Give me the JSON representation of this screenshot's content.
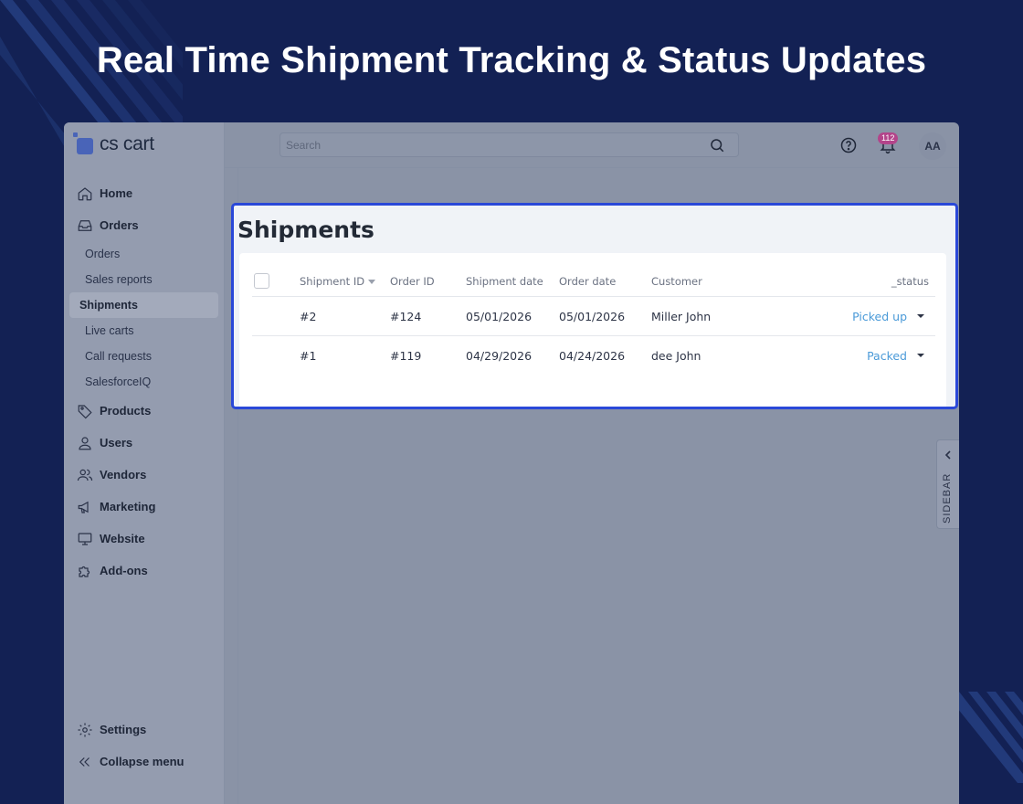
{
  "headline": "Real Time Shipment Tracking & Status Updates",
  "app": {
    "logo_text": "cs cart"
  },
  "search": {
    "placeholder": "Search"
  },
  "header": {
    "notifications_count": "112",
    "avatar_initials": "AA"
  },
  "sidebar": {
    "items": [
      {
        "label": "Home",
        "icon": "home-icon"
      },
      {
        "label": "Orders",
        "icon": "inbox-icon"
      },
      {
        "label": "Orders"
      },
      {
        "label": "Sales reports"
      },
      {
        "label": "Shipments"
      },
      {
        "label": "Live carts"
      },
      {
        "label": "Call requests"
      },
      {
        "label": "SalesforceIQ"
      },
      {
        "label": "Products",
        "icon": "tag-icon"
      },
      {
        "label": "Users",
        "icon": "user-icon"
      },
      {
        "label": "Vendors",
        "icon": "users-icon"
      },
      {
        "label": "Marketing",
        "icon": "megaphone-icon"
      },
      {
        "label": "Website",
        "icon": "monitor-icon"
      },
      {
        "label": "Add-ons",
        "icon": "puzzle-icon"
      }
    ],
    "bottom": [
      {
        "label": "Settings",
        "icon": "gear-icon"
      },
      {
        "label": "Collapse menu",
        "icon": "double-chevron-left-icon"
      }
    ]
  },
  "main": {
    "title": "Shipments",
    "columns": [
      "Shipment ID",
      "Order ID",
      "Shipment date",
      "Order date",
      "Customer",
      "_status"
    ],
    "rows": [
      {
        "shipment_id": "#2",
        "order_id": "#124",
        "shipment_date": "05/01/2026",
        "order_date": "05/01/2026",
        "customer": "Miller John",
        "status": "Picked up"
      },
      {
        "shipment_id": "#1",
        "order_id": "#119",
        "shipment_date": "04/29/2026",
        "order_date": "04/24/2026",
        "customer": "dee John",
        "status": "Packed"
      }
    ]
  },
  "right_tab": {
    "label": "SIDEBAR"
  },
  "colors": {
    "accent": "#2a48d8",
    "link": "#4a9ad8",
    "background": "#132154",
    "badge": "#b3448a"
  }
}
